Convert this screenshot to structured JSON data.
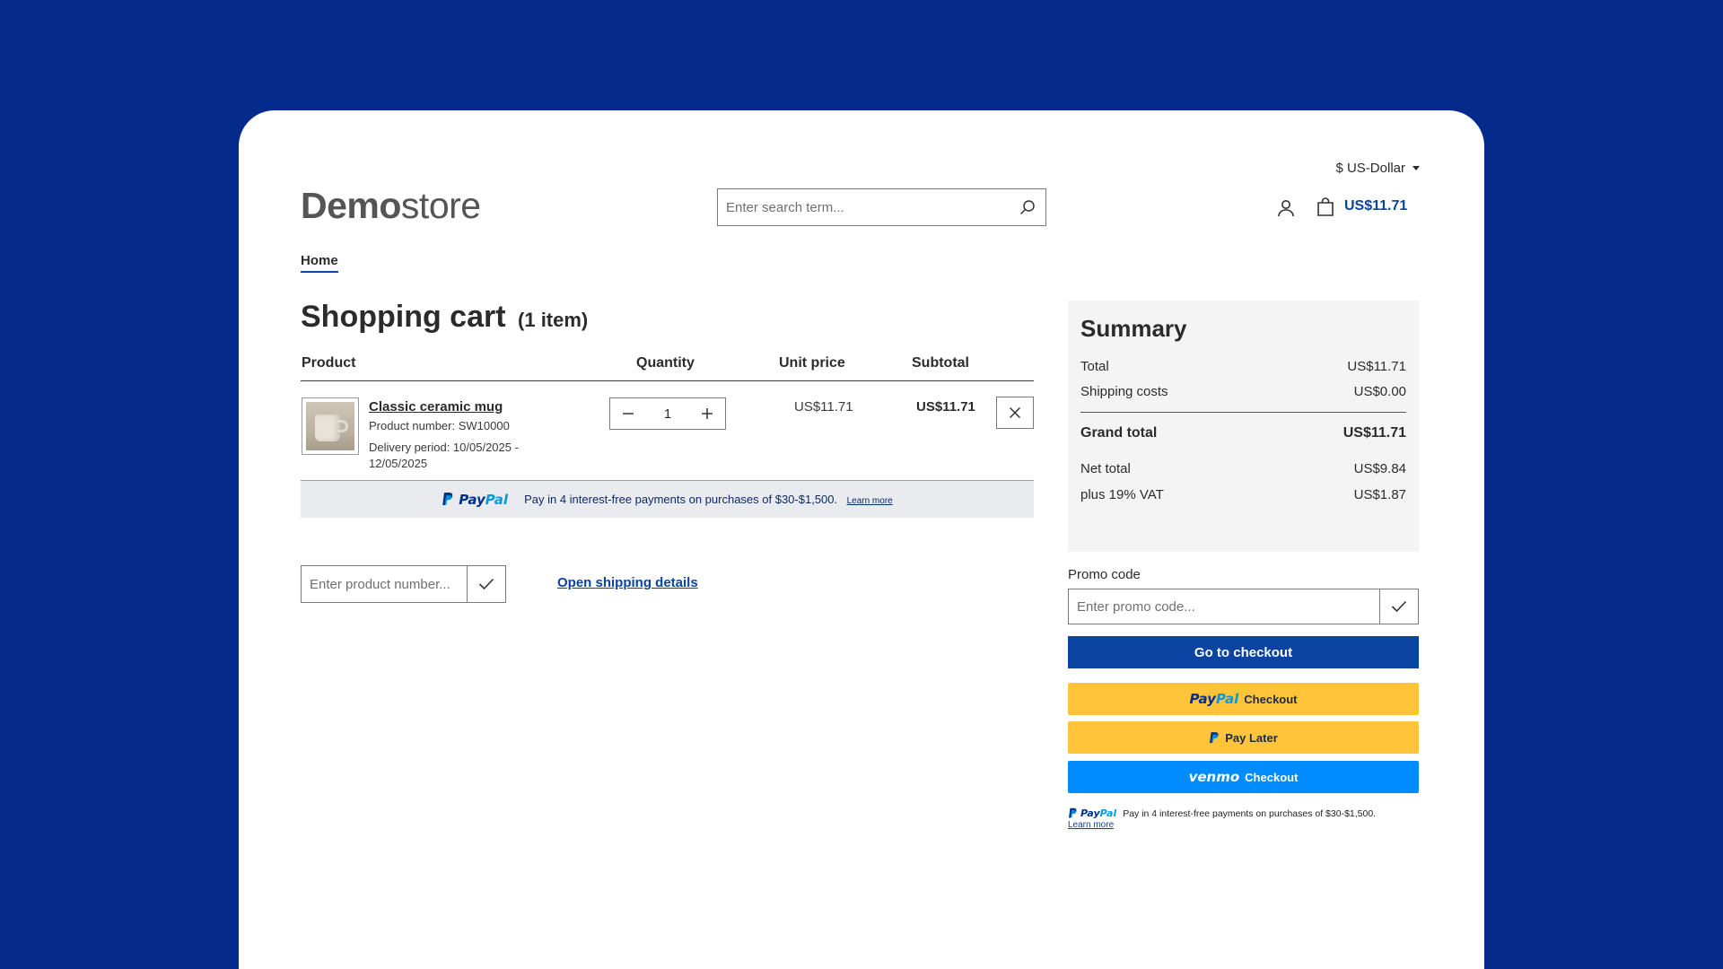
{
  "header": {
    "logo_bold": "Demo",
    "logo_light": "store",
    "currency": "$ US-Dollar",
    "search_placeholder": "Enter search term...",
    "cart_total": "US$11.71"
  },
  "breadcrumb": {
    "home": "Home"
  },
  "cart": {
    "title": "Shopping cart",
    "item_count": "(1 item)",
    "columns": {
      "product": "Product",
      "quantity": "Quantity",
      "unit_price": "Unit price",
      "subtotal": "Subtotal"
    },
    "items": [
      {
        "name": "Classic ceramic mug",
        "product_number": "Product number: SW10000",
        "delivery_line1": "Delivery period: 10/05/2025 -",
        "delivery_line2": "12/05/2025",
        "quantity": "1",
        "unit_price": "US$11.71",
        "subtotal": "US$11.71"
      }
    ],
    "paypal_banner": {
      "brand_a": "Pay",
      "brand_b": "Pal",
      "text": "Pay in 4 interest-free payments on purchases of $30-$1,500.",
      "learn_more": "Learn more"
    },
    "product_number_placeholder": "Enter product number...",
    "shipping_link": "Open shipping details"
  },
  "summary": {
    "title": "Summary",
    "rows": [
      {
        "label": "Total",
        "value": "US$11.71"
      },
      {
        "label": "Shipping costs",
        "value": "US$0.00"
      }
    ],
    "grand_total": {
      "label": "Grand total",
      "value": "US$11.71"
    },
    "net_total": {
      "label": "Net total",
      "value": "US$9.84"
    },
    "vat": {
      "label": "plus 19% VAT",
      "value": "US$1.87"
    }
  },
  "promo": {
    "label": "Promo code",
    "placeholder": "Enter promo code..."
  },
  "checkout": {
    "go_to_checkout": "Go to checkout",
    "paypal_a": "Pay",
    "paypal_b": "Pal",
    "paypal_checkout": "Checkout",
    "pay_later": "Pay Later",
    "venmo_word": "venmo",
    "venmo_checkout": "Checkout",
    "mini_brand_a": "Pay",
    "mini_brand_b": "Pal",
    "mini_text": "Pay in 4 interest-free payments on purchases of $30-$1,500.",
    "mini_learn": "Learn more"
  },
  "colors": {
    "background": "#042a8c",
    "primary": "#0b43a3",
    "paypal_yellow": "#ffc43a",
    "venmo_blue": "#008cff"
  }
}
